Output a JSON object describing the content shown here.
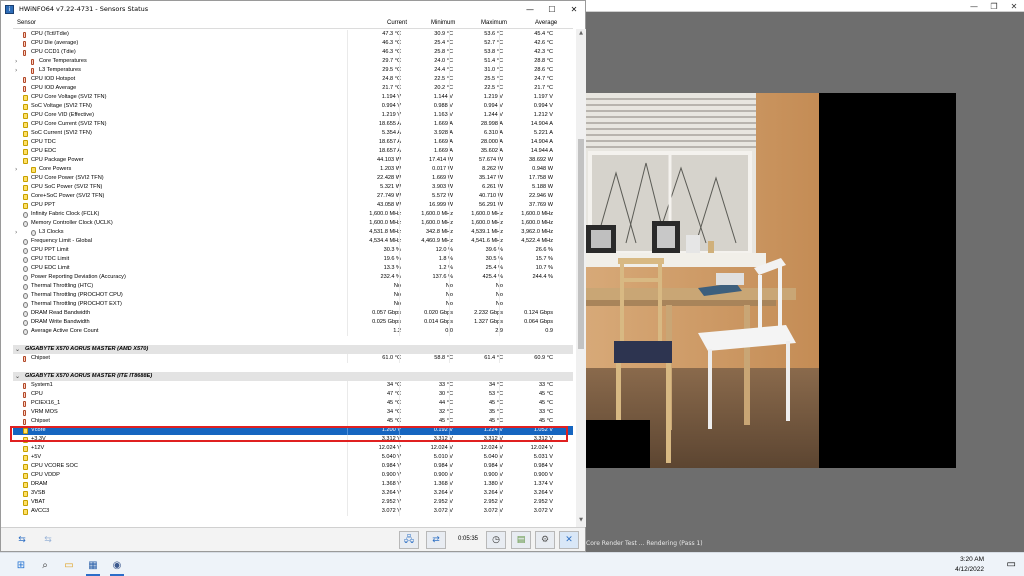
{
  "hwinfo": {
    "title": "HWiNFO64 v7.22-4731 - Sensors Status",
    "icon": "hwinfo-app-icon",
    "controls": {
      "minimize": "—",
      "maximize": "☐",
      "close": "✕"
    },
    "columns": {
      "sensor": "Sensor",
      "current": "Current",
      "minimum": "Minimum",
      "maximum": "Maximum",
      "average": "Average"
    },
    "rows": [
      {
        "label": "CPU (Tctl/Tdie)",
        "cur": "47.3 °C",
        "min": "30.9 °C",
        "max": "53.6 °C",
        "avg": "45.4 °C",
        "icon": "therm"
      },
      {
        "label": "CPU Die (average)",
        "cur": "46.3 °C",
        "min": "25.4 °C",
        "max": "52.7 °C",
        "avg": "42.6 °C",
        "icon": "therm"
      },
      {
        "label": "CPU CCD1 (Tdie)",
        "cur": "46.3 °C",
        "min": "25.8 °C",
        "max": "53.8 °C",
        "avg": "42.3 °C",
        "icon": "therm"
      },
      {
        "label": "Core Temperatures",
        "cur": "29.7 °C",
        "min": "24.0 °C",
        "max": "51.4 °C",
        "avg": "28.8 °C",
        "icon": "therm",
        "expand": true
      },
      {
        "label": "L3 Temperatures",
        "cur": "29.5 °C",
        "min": "24.4 °C",
        "max": "31.0 °C",
        "avg": "28.6 °C",
        "icon": "therm",
        "expand": true
      },
      {
        "label": "CPU IOD Hotspot",
        "cur": "24.8 °C",
        "min": "22.5 °C",
        "max": "25.5 °C",
        "avg": "24.7 °C",
        "icon": "therm"
      },
      {
        "label": "CPU IOD Average",
        "cur": "21.7 °C",
        "min": "20.2 °C",
        "max": "22.5 °C",
        "avg": "21.7 °C",
        "icon": "therm"
      },
      {
        "label": "CPU Core Voltage (SVI2 TFN)",
        "cur": "1.194 V",
        "min": "1.144 V",
        "max": "1.219 V",
        "avg": "1.197 V",
        "icon": "bolt"
      },
      {
        "label": "SoC Voltage (SVI2 TFN)",
        "cur": "0.994 V",
        "min": "0.988 V",
        "max": "0.994 V",
        "avg": "0.994 V",
        "icon": "bolt"
      },
      {
        "label": "CPU Core VID (Effective)",
        "cur": "1.219 V",
        "min": "1.163 V",
        "max": "1.244 V",
        "avg": "1.212 V",
        "icon": "bolt"
      },
      {
        "label": "CPU Core Current (SVI2 TFN)",
        "cur": "18.655 A",
        "min": "1.669 A",
        "max": "28.998 A",
        "avg": "14.904 A",
        "icon": "bolt"
      },
      {
        "label": "SoC Current (SVI2 TFN)",
        "cur": "5.354 A",
        "min": "3.928 A",
        "max": "6.310 A",
        "avg": "5.221 A",
        "icon": "bolt"
      },
      {
        "label": "CPU TDC",
        "cur": "18.657 A",
        "min": "1.669 A",
        "max": "28.000 A",
        "avg": "14.904 A",
        "icon": "bolt"
      },
      {
        "label": "CPU EDC",
        "cur": "18.657 A",
        "min": "1.669 A",
        "max": "35.602 A",
        "avg": "14.944 A",
        "icon": "bolt"
      },
      {
        "label": "CPU Package Power",
        "cur": "44.103 W",
        "min": "17.414 W",
        "max": "57.674 W",
        "avg": "38.692 W",
        "icon": "bolt"
      },
      {
        "label": "Core Powers",
        "cur": "1.203 W",
        "min": "0.017 W",
        "max": "8.262 W",
        "avg": "0.948 W",
        "icon": "bolt",
        "expand": true
      },
      {
        "label": "CPU Core Power (SVI2 TFN)",
        "cur": "22.428 W",
        "min": "1.669 W",
        "max": "35.147 W",
        "avg": "17.758 W",
        "icon": "bolt"
      },
      {
        "label": "CPU SoC Power (SVI2 TFN)",
        "cur": "5.321 W",
        "min": "3.903 W",
        "max": "6.261 W",
        "avg": "5.188 W",
        "icon": "bolt"
      },
      {
        "label": "Core+SoC Power (SVI2 TFN)",
        "cur": "27.749 W",
        "min": "5.572 W",
        "max": "40.710 W",
        "avg": "22.946 W",
        "icon": "bolt"
      },
      {
        "label": "CPU PPT",
        "cur": "43.058 W",
        "min": "16.999 W",
        "max": "56.291 W",
        "avg": "37.769 W",
        "icon": "bolt"
      },
      {
        "label": "Infinity Fabric Clock (FCLK)",
        "cur": "1,600.0 MHz",
        "min": "1,600.0 MHz",
        "max": "1,600.0 MHz",
        "avg": "1,600.0 MHz",
        "icon": "circle"
      },
      {
        "label": "Memory Controller Clock (UCLK)",
        "cur": "1,600.0 MHz",
        "min": "1,600.0 MHz",
        "max": "1,600.0 MHz",
        "avg": "1,600.0 MHz",
        "icon": "circle"
      },
      {
        "label": "L3 Clocks",
        "cur": "4,531.8 MHz",
        "min": "342.8 MHz",
        "max": "4,539.1 MHz",
        "avg": "3,962.0 MHz",
        "icon": "circle",
        "expand": true
      },
      {
        "label": "Frequency Limit - Global",
        "cur": "4,534.4 MHz",
        "min": "4,460.9 MHz",
        "max": "4,541.6 MHz",
        "avg": "4,522.4 MHz",
        "icon": "circle"
      },
      {
        "label": "CPU PPT Limit",
        "cur": "30.3 %",
        "min": "12.0 %",
        "max": "39.6 %",
        "avg": "26.6 %",
        "icon": "circle"
      },
      {
        "label": "CPU TDC Limit",
        "cur": "19.6 %",
        "min": "1.8 %",
        "max": "30.5 %",
        "avg": "15.7 %",
        "icon": "circle"
      },
      {
        "label": "CPU EDC Limit",
        "cur": "13.3 %",
        "min": "1.2 %",
        "max": "25.4 %",
        "avg": "10.7 %",
        "icon": "circle"
      },
      {
        "label": "Power Reporting Deviation (Accuracy)",
        "cur": "232.4 %",
        "min": "137.6 %",
        "max": "425.4 %",
        "avg": "244.4 %",
        "icon": "circle"
      },
      {
        "label": "Thermal Throttling (HTC)",
        "cur": "No",
        "min": "No",
        "max": "No",
        "avg": "",
        "icon": "circle"
      },
      {
        "label": "Thermal Throttling (PROCHOT CPU)",
        "cur": "No",
        "min": "No",
        "max": "No",
        "avg": "",
        "icon": "circle"
      },
      {
        "label": "Thermal Throttling (PROCHOT EXT)",
        "cur": "No",
        "min": "No",
        "max": "No",
        "avg": "",
        "icon": "circle"
      },
      {
        "label": "DRAM Read Bandwidth",
        "cur": "0.057 Gbps",
        "min": "0.020 Gbps",
        "max": "2.232 Gbps",
        "avg": "0.124 Gbps",
        "icon": "circle"
      },
      {
        "label": "DRAM Write Bandwidth",
        "cur": "0.025 Gbps",
        "min": "0.014 Gbps",
        "max": "1.327 Gbps",
        "avg": "0.064 Gbps",
        "icon": "circle"
      },
      {
        "label": "Average Active Core Count",
        "cur": "1.2",
        "min": "0.0",
        "max": "2.9",
        "avg": "0.9",
        "icon": "circle"
      },
      {
        "label": "",
        "cur": "",
        "min": "",
        "max": "",
        "avg": "",
        "icon": "none"
      },
      {
        "label": "GIGABYTE X570 AORUS MASTER (AMD X570)",
        "cur": "",
        "min": "",
        "max": "",
        "avg": "",
        "icon": "none",
        "group": true
      },
      {
        "label": "Chipset",
        "cur": "61.0 °C",
        "min": "58.8 °C",
        "max": "61.4 °C",
        "avg": "60.9 °C",
        "icon": "therm"
      },
      {
        "label": "",
        "cur": "",
        "min": "",
        "max": "",
        "avg": "",
        "icon": "none"
      },
      {
        "label": "GIGABYTE X570 AORUS MASTER (ITE IT8688E)",
        "cur": "",
        "min": "",
        "max": "",
        "avg": "",
        "icon": "none",
        "group": true
      },
      {
        "label": "System1",
        "cur": "34 °C",
        "min": "33 °C",
        "max": "34 °C",
        "avg": "33 °C",
        "icon": "therm"
      },
      {
        "label": "CPU",
        "cur": "47 °C",
        "min": "30 °C",
        "max": "53 °C",
        "avg": "45 °C",
        "icon": "therm"
      },
      {
        "label": "PCIEX16_1",
        "cur": "45 °C",
        "min": "44 °C",
        "max": "45 °C",
        "avg": "45 °C",
        "icon": "therm"
      },
      {
        "label": "VRM MOS",
        "cur": "34 °C",
        "min": "32 °C",
        "max": "35 °C",
        "avg": "33 °C",
        "icon": "therm"
      },
      {
        "label": "Chipset",
        "cur": "45 °C",
        "min": "45 °C",
        "max": "45 °C",
        "avg": "45 °C",
        "icon": "therm"
      },
      {
        "label": "Vcore",
        "cur": "1.200 V",
        "min": "0.192 V",
        "max": "1.224 V",
        "avg": "1.052 V",
        "icon": "bolt",
        "selected": true
      },
      {
        "label": "+3.3V",
        "cur": "3.312 V",
        "min": "3.312 V",
        "max": "3.312 V",
        "avg": "3.312 V",
        "icon": "bolt"
      },
      {
        "label": "+12V",
        "cur": "12.024 V",
        "min": "12.024 V",
        "max": "12.024 V",
        "avg": "12.024 V",
        "icon": "bolt"
      },
      {
        "label": "+5V",
        "cur": "5.040 V",
        "min": "5.010 V",
        "max": "5.040 V",
        "avg": "5.031 V",
        "icon": "bolt"
      },
      {
        "label": "CPU VCORE SOC",
        "cur": "0.984 V",
        "min": "0.984 V",
        "max": "0.984 V",
        "avg": "0.984 V",
        "icon": "bolt"
      },
      {
        "label": "CPU VDDP",
        "cur": "0.900 V",
        "min": "0.900 V",
        "max": "0.900 V",
        "avg": "0.900 V",
        "icon": "bolt"
      },
      {
        "label": "DRAM",
        "cur": "1.368 V",
        "min": "1.368 V",
        "max": "1.380 V",
        "avg": "1.374 V",
        "icon": "bolt"
      },
      {
        "label": "3VSB",
        "cur": "3.264 V",
        "min": "3.264 V",
        "max": "3.264 V",
        "avg": "3.264 V",
        "icon": "bolt"
      },
      {
        "label": "VBAT",
        "cur": "2.952 V",
        "min": "2.952 V",
        "max": "2.952 V",
        "avg": "2.952 V",
        "icon": "bolt"
      },
      {
        "label": "AVCC3",
        "cur": "3.072 V",
        "min": "3.072 V",
        "max": "3.072 V",
        "avg": "3.072 V",
        "icon": "bolt"
      }
    ],
    "bottom": {
      "timer": "0:05:35"
    }
  },
  "background_app": {
    "status": "Core Render Test ... Rendering (Pass 1)"
  },
  "taskbar": {
    "time": "3:20 AM",
    "date": "4/12/2022"
  }
}
